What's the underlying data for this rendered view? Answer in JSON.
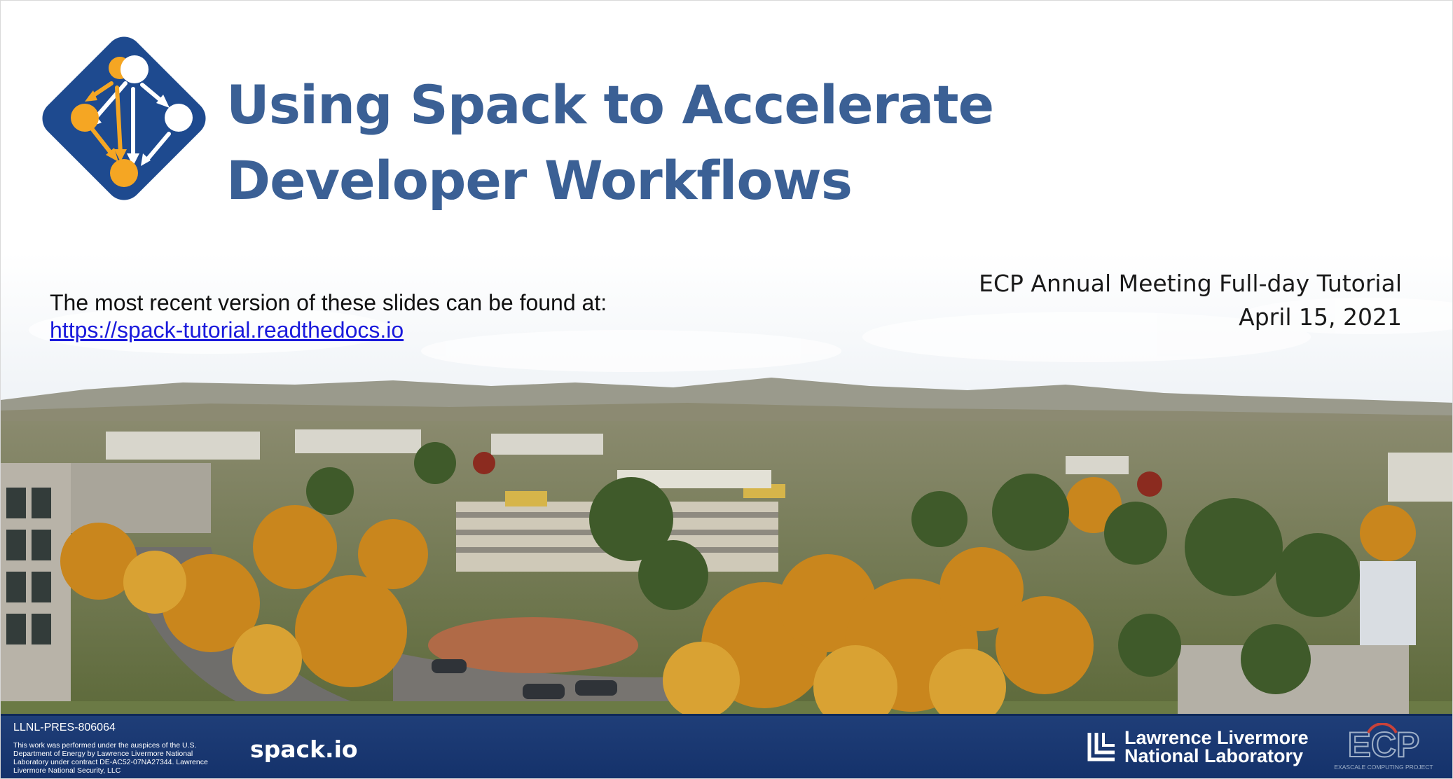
{
  "slide": {
    "title_line1": "Using Spack to Accelerate",
    "title_line2": "Developer Workflows",
    "event_line1": "ECP Annual Meeting Full-day Tutorial",
    "event_line2": "April 15, 2021",
    "recent_text": "The most recent version of these slides can be found at:",
    "recent_link": "https://spack-tutorial.readthedocs.io"
  },
  "footer": {
    "pres_id": "LLNL-PRES-806064",
    "fine_print": "This work was performed under the auspices of the U.S. Department of Energy by Lawrence Livermore National Laboratory under contract DE-AC52-07NA27344. Lawrence Livermore National Security, LLC",
    "site": "spack.io",
    "llnl_line1": "Lawrence Livermore",
    "llnl_line2": "National Laboratory",
    "ecp_logo_text": "ECP",
    "ecp_logo_subtext": "EXASCALE COMPUTING PROJECT"
  },
  "colors": {
    "title": "#3b6095",
    "footer": "#1f3e78",
    "logo_bg": "#1e4a8f",
    "logo_orange": "#f5a623",
    "link": "#1a1adc"
  },
  "icons": [
    "spack-logo",
    "llnl-logo",
    "ecp-logo"
  ]
}
